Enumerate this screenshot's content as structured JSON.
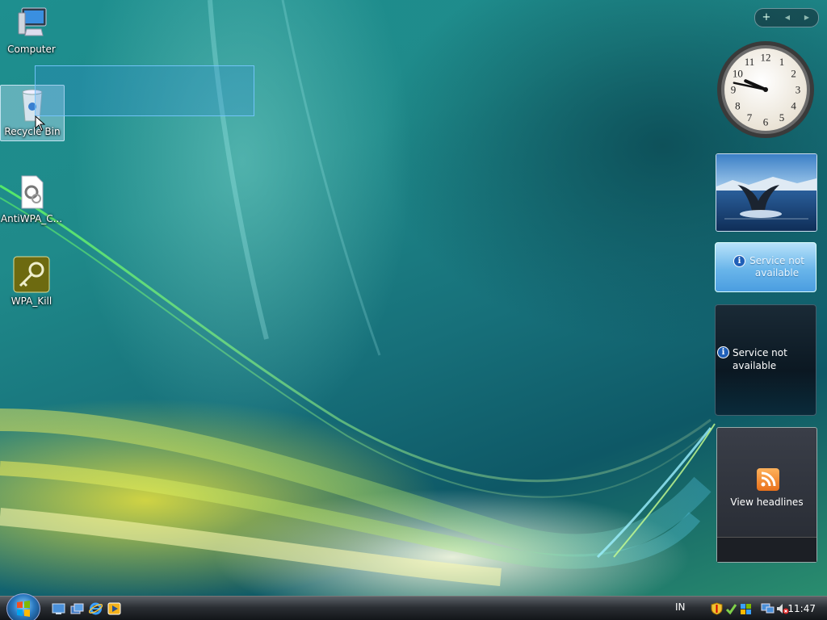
{
  "desktop": {
    "icons": [
      {
        "label": "Computer"
      },
      {
        "label": "Recycle Bin"
      },
      {
        "label": "AntiWPA_C..."
      },
      {
        "label": "WPA_Kill"
      }
    ]
  },
  "sidebar": {
    "controls": {
      "add": "+",
      "prev": "◀",
      "next": "▶"
    },
    "clock": {
      "hour": 9,
      "minute": 47,
      "numerals": [
        "12",
        "1",
        "2",
        "3",
        "4",
        "5",
        "6",
        "7",
        "8",
        "9",
        "10",
        "11"
      ]
    },
    "weather": {
      "message": "Service not available"
    },
    "cpu": {
      "message": "Service not available"
    },
    "feed": {
      "label": "View headlines"
    }
  },
  "taskbar": {
    "language": "IN",
    "time": "11:47"
  },
  "colors": {
    "accent": "#1f5fb8",
    "rss": "#f08a24"
  }
}
